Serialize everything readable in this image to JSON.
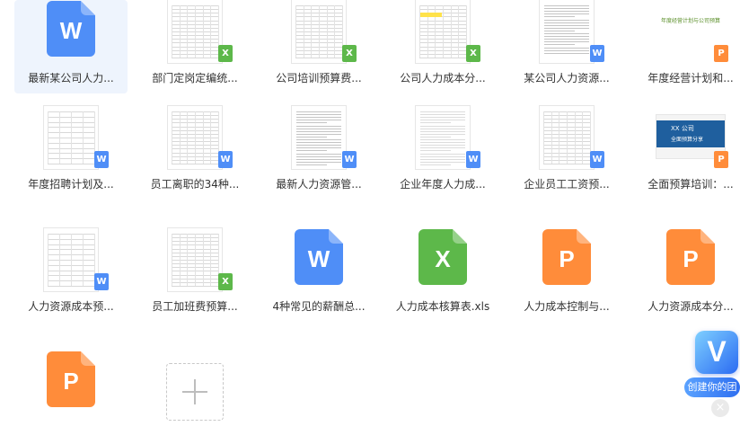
{
  "files": [
    {
      "name": "最新某公司人力...",
      "type": "word",
      "preview": "icon",
      "selected": true
    },
    {
      "name": "部门定岗定编统...",
      "type": "excel",
      "preview": "table"
    },
    {
      "name": "公司培训预算费...",
      "type": "excel",
      "preview": "table"
    },
    {
      "name": "公司人力成本分...",
      "type": "excel",
      "preview": "table-yellow"
    },
    {
      "name": "某公司人力资源...",
      "type": "word",
      "preview": "doc"
    },
    {
      "name": "年度经营计划和...",
      "type": "ppt",
      "preview": "ppt-title",
      "preview_text": "年度经营计划与公司预算"
    },
    {
      "name": "年度招聘计划及...",
      "type": "word",
      "preview": "form"
    },
    {
      "name": "员工离职的34种...",
      "type": "word",
      "preview": "table"
    },
    {
      "name": "最新人力资源管...",
      "type": "word",
      "preview": "text"
    },
    {
      "name": "企业年度人力成...",
      "type": "word",
      "preview": "text-light"
    },
    {
      "name": "企业员工工资预...",
      "type": "word",
      "preview": "table"
    },
    {
      "name": "全面预算培训：...",
      "type": "ppt",
      "preview": "ppt-banner",
      "preview_text": [
        "XX 公司",
        "全面预算分享"
      ]
    },
    {
      "name": "人力资源成本预...",
      "type": "word",
      "preview": "form"
    },
    {
      "name": "员工加班费预算...",
      "type": "excel",
      "preview": "table"
    },
    {
      "name": "4种常见的薪酬总...",
      "type": "word",
      "preview": "icon"
    },
    {
      "name": "人力成本核算表.xls",
      "type": "excel",
      "preview": "icon"
    },
    {
      "name": "人力成本控制与...",
      "type": "ppt",
      "preview": "icon"
    },
    {
      "name": "人力资源成本分...",
      "type": "ppt",
      "preview": "icon"
    },
    {
      "name": "",
      "type": "ppt",
      "preview": "icon"
    }
  ],
  "badges": {
    "word": "W",
    "excel": "X",
    "ppt": "P"
  },
  "colors": {
    "word": "#4f8ef7",
    "excel": "#5db84a",
    "ppt": "#ff8c3a"
  },
  "add_tile": {
    "icon": "plus-icon"
  },
  "promo": {
    "logo_letter": "V",
    "label": "创建你的团",
    "close": "×"
  }
}
